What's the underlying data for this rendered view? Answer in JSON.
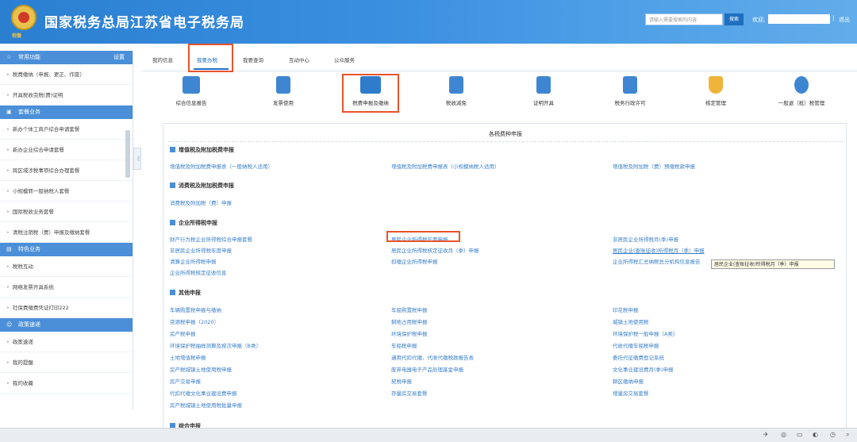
{
  "header": {
    "title": "国家税务总局江苏省电子税务局",
    "emblem_text": "税徽",
    "search_placeholder": "请输入需要搜索的内容",
    "search_button": "搜索",
    "welcome": "欢迎,",
    "separator": "|",
    "logout": "退出"
  },
  "sidebar": {
    "sections": [
      {
        "title": "常用功能",
        "setting": "设置",
        "items": [
          "税费缴纳（申报、更正、作废）",
          "开具税收完税(费)证明"
        ]
      },
      {
        "title": "套餐业务",
        "items": [
          "新办个体工商户综合申请套餐",
          "新办企业综合申请套餐",
          "跨区域涉税事项综合办理套餐",
          "小规模转一般纳税人套餐",
          "国际税收业务套餐",
          "清税注销税（费）申报及缴纳套餐"
        ]
      },
      {
        "title": "特色业务",
        "items": [
          "税税互动",
          "网络发票开具系统",
          "社保费缴费凭证打印222"
        ]
      },
      {
        "title": "政策速递",
        "items": [
          "政策速递",
          "我的提醒",
          "我的收藏"
        ]
      }
    ],
    "collapse": "《"
  },
  "tabs": [
    {
      "label": "我的信息"
    },
    {
      "label": "我要办税"
    },
    {
      "label": "我要查询"
    },
    {
      "label": "互动中心"
    },
    {
      "label": "公众服务"
    }
  ],
  "services": [
    {
      "label": "综合信息报告",
      "icon": "monitor-icon",
      "color": "#3e86d2"
    },
    {
      "label": "发票使用",
      "icon": "invoice-icon",
      "color": "#3e86d2"
    },
    {
      "label": "税费申报及缴纳",
      "icon": "tax-filing-icon",
      "color": "#2f7ccc"
    },
    {
      "label": "税收减免",
      "icon": "calculator-icon",
      "color": "#3e86d2"
    },
    {
      "label": "证明开具",
      "icon": "certificate-icon",
      "color": "#3e86d2"
    },
    {
      "label": "税务行政许可",
      "icon": "license-icon",
      "color": "#3e86d2"
    },
    {
      "label": "核定管理",
      "icon": "shield-icon",
      "color": "#f0b43a"
    },
    {
      "label": "一般退（抵）税管理",
      "icon": "network-icon",
      "color": "#3e86d2"
    }
  ],
  "panel": {
    "title": "各税费种申报",
    "categories": [
      {
        "title": "增值税及附加税费申报",
        "links": [
          "增值税及附加税费申报表（一般纳税人适用）",
          "增值税及附加税费申报表（小规模纳税人适用）",
          "增值税及附加税（费）预缴税款申报"
        ]
      },
      {
        "title": "消费税及附加税费申报",
        "links": [
          "消费税及附加税（费）申报"
        ]
      },
      {
        "title": "企业所得税申报",
        "links": [
          "财产行为税企业所得税综合申报套餐",
          "居民企业所得税年度申报",
          "非居民企业所得税月(季)申报",
          "非居民企业所得税年度申报",
          "居民企业所得税核定征收月（季）申报",
          "居民企业(查账征收)所得税月（季）申报",
          "清算企业所得税申报",
          "扣缴企业所得税申报",
          "企业所得税汇总纳税总分机构信息报告",
          "企业所得税核定征收信息"
        ]
      },
      {
        "title": "其他申报",
        "links": [
          "车辆购置税申报与缴纳",
          "车船购置税申报",
          "印花税申报",
          "资源税申报（2020）",
          "耕地占用税申报",
          "城镇土地使用税",
          "房产税申报",
          "环境保护税申报",
          "环境保护税一般申报（A类）",
          "环境保护税抽样测算及按次申报（B类）",
          "车船税申报",
          "代收代缴车船税申报",
          "土地增值税申报",
          "通用代扣代缴、代收代缴税款报告表",
          "委托代征缴费登记系统",
          "房产税城镇土地使用税申报",
          "废弃电器电子产品处理基金申报",
          "文化事业建设费月(季)申报",
          "房产交易申报",
          "契税申报",
          "耕区缴纳申报",
          "代扣代缴文化事业建设费申报",
          "存量房交易套餐",
          "增量房交易套餐",
          "房产税城镇土地使用税批量申报"
        ]
      },
      {
        "title": "综合申报",
        "links": []
      }
    ],
    "tooltip": "居民企业(查账征收)所得税月（季）申报"
  },
  "taskbar": {
    "icons": [
      "network-icon",
      "volume-icon",
      "battery-icon",
      "ime-icon",
      "clock-icon"
    ]
  }
}
